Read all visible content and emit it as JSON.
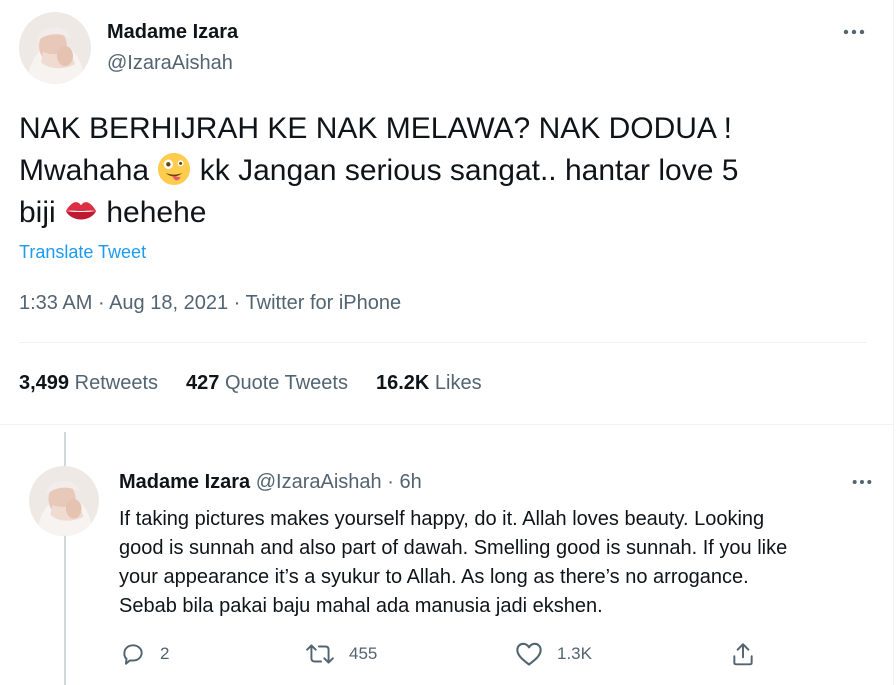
{
  "tweet": {
    "author_name": "Madame Izara",
    "author_handle": "@IzaraAishah",
    "text_lines": [
      "NAK BERHIJRAH KE NAK MELAWA? NAK DODUA !",
      "Mwahaha",
      "kk Jangan serious sangat.. hantar love 5",
      "biji",
      "hehehe"
    ],
    "emoji": [
      "zany-face-emoji",
      "kiss-mark-emoji"
    ],
    "translate_label": "Translate Tweet",
    "time": "1:33 AM",
    "date": "Aug 18, 2021",
    "source": "Twitter for iPhone",
    "separator": "·",
    "stats": {
      "retweets_count": "3,499",
      "retweets_label": "Retweets",
      "quotes_count": "427",
      "quotes_label": "Quote Tweets",
      "likes_count": "16.2K",
      "likes_label": "Likes"
    }
  },
  "reply": {
    "author_name": "Madame Izara",
    "author_handle": "@IzaraAishah",
    "separator": "·",
    "age": "6h",
    "text_lines": [
      "If taking pictures makes yourself happy, do it. Allah loves beauty. Looking",
      "good is sunnah and also part of dawah. Smelling good is sunnah. If you like",
      "your appearance it’s a syukur to Allah. As long as there’s no arrogance.",
      "Sebab bila pakai baju mahal ada manusia jadi ekshen."
    ],
    "actions": {
      "replies": "2",
      "retweets": "455",
      "likes": "1.3K"
    }
  },
  "icons": {
    "more": "more-horizontal-icon",
    "reply": "reply-bubble-icon",
    "retweet": "retweet-icon",
    "like": "heart-icon",
    "share": "share-icon"
  },
  "colors": {
    "text_primary": "#0f1419",
    "text_secondary": "#536471",
    "link": "#1d9bf0",
    "divider": "#eff3f4",
    "thread_line": "#cfd9de"
  }
}
